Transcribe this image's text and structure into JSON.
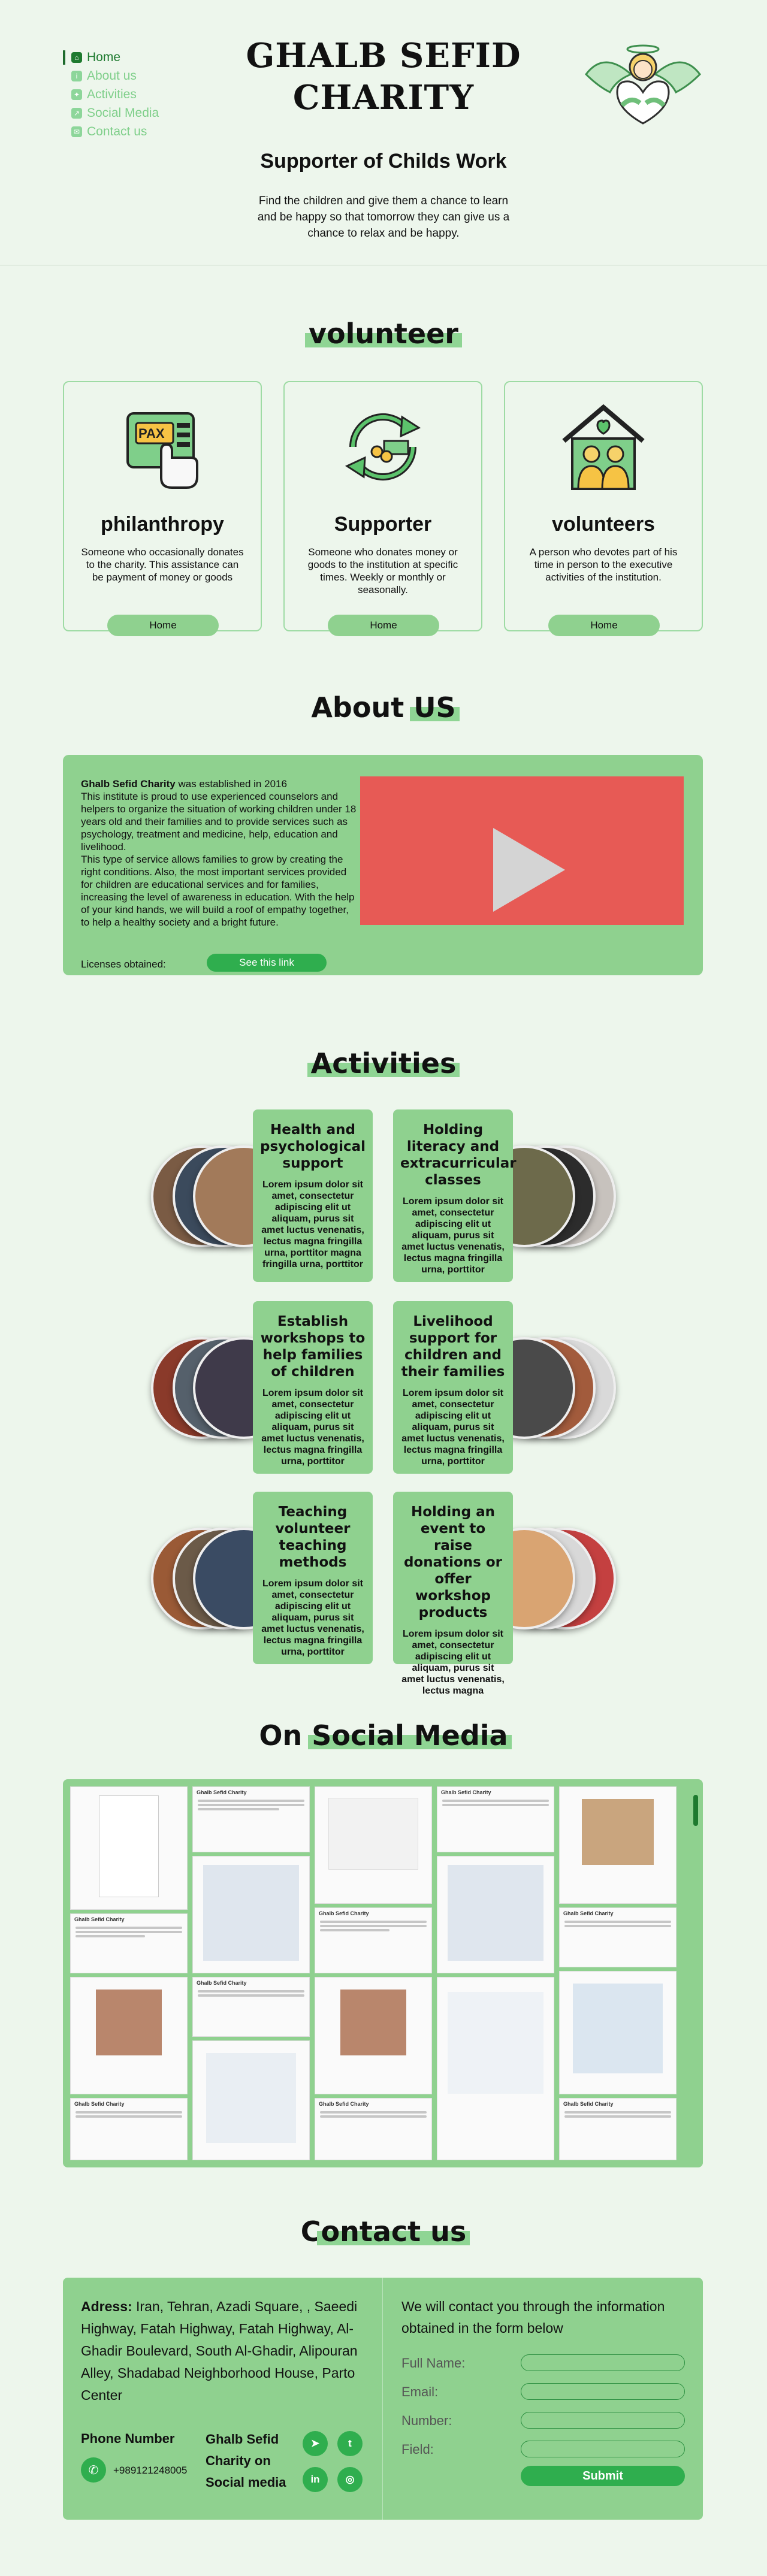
{
  "nav": {
    "items": [
      {
        "label": "Home",
        "icon": "home-icon"
      },
      {
        "label": "About us",
        "icon": "info-icon"
      },
      {
        "label": "Activities",
        "icon": "activity-icon"
      },
      {
        "label": "Social Media",
        "icon": "share-icon"
      },
      {
        "label": "Contact us",
        "icon": "chat-icon"
      }
    ]
  },
  "header": {
    "brand_line1": "GHALB SEFID",
    "brand_line2": "CHARITY",
    "tagline": "Supporter of Childs Work",
    "intro": "Find the children and give them a chance to learn and be happy so that tomorrow they can give us a chance to relax and be happy."
  },
  "volunteer": {
    "title": "volunteer",
    "cards": [
      {
        "title": "philanthropy",
        "text": "Someone who occasionally donates to the charity. This assistance can be payment of money or goods",
        "button": "Home",
        "icon": "pax-card-icon"
      },
      {
        "title": "Supporter",
        "text": "Someone who donates money or goods to the institution at specific times. Weekly or monthly or seasonally.",
        "button": "Home",
        "icon": "cycle-money-icon"
      },
      {
        "title": "volunteers",
        "text": "A person who devotes part of his time in person to the executive activities of the institution.",
        "button": "Home",
        "icon": "house-people-icon"
      }
    ]
  },
  "about": {
    "title_plain": "About ",
    "title_hl": "US",
    "brand": "Ghalb Sefid Charity",
    "text1": " was established in 2016",
    "text2": "This institute is proud to use experienced counselors and helpers to organize the situation of working children under 18 years old and their families and to provide services such as psychology, treatment and medicine, help, education and livelihood.",
    "text3": "This type of service allows families to grow by creating the right conditions. Also, the most important services provided for children are educational services and for families, increasing the level of awareness in education. With the help of your kind hands, we will build a roof of empathy together, to help a healthy society and a bright future.",
    "licenses_label": "Licenses obtained:",
    "licenses_button": "See this link"
  },
  "activities": {
    "title": "Activities",
    "items": [
      {
        "title": "Health and psychological support",
        "text": "Lorem ipsum dolor sit amet, consectetur adipiscing elit ut aliquam, purus sit amet luctus venenatis, lectus magna fringilla urna, porttitor magna fringilla urna, porttitor"
      },
      {
        "title": "Holding literacy and extracurricular classes",
        "text": "Lorem ipsum dolor sit amet, consectetur adipiscing elit ut aliquam, purus sit amet luctus venenatis, lectus magna fringilla urna, porttitor"
      },
      {
        "title": "Establish workshops to help families of children",
        "text": "Lorem ipsum dolor sit amet, consectetur adipiscing elit ut aliquam, purus sit amet luctus venenatis, lectus magna fringilla urna, porttitor"
      },
      {
        "title": "Livelihood support for children and their families",
        "text": "Lorem ipsum dolor sit amet, consectetur adipiscing elit ut aliquam, purus sit amet luctus venenatis, lectus magna fringilla urna, porttitor"
      },
      {
        "title": "Teaching volunteer teaching methods",
        "text": "Lorem ipsum dolor sit amet, consectetur adipiscing elit ut aliquam, purus sit amet luctus venenatis, lectus magna fringilla urna, porttitor"
      },
      {
        "title": "Holding an event to raise donations or offer workshop products",
        "text": "Lorem ipsum dolor sit amet, consectetur adipiscing elit ut aliquam, purus sit amet luctus venenatis, lectus magna"
      }
    ]
  },
  "social": {
    "title_plain": "On ",
    "title_hl": "Social Media",
    "post_author": "Ghalb Sefid Charity"
  },
  "contact": {
    "title_plain": "C",
    "title_hl": "ontact us",
    "address_label": "Adress:",
    "address": " Iran, Tehran,  Azadi Square, , Saeedi Highway, Fatah Highway, Fatah Highway, Al-Ghadir Boulevard, South Al-Ghadir, Alipouran Alley, Shadabad Neighborhood House, Parto Center",
    "phone_label": "Phone Number",
    "phone": "+989121248005",
    "social_label": "Ghalb Sefid Charity on Social media",
    "form_head": "We will contact you through the information obtained in the form below",
    "fields": [
      "Full Name:",
      "Email:",
      "Number:",
      "Field:"
    ],
    "submit": "Submit"
  },
  "colors": {
    "accent": "#8fd18f",
    "accent_dark": "#2fae4e",
    "nav_active": "#1e7a2f",
    "bg": "#edf6ec",
    "video": "#e75a55"
  }
}
